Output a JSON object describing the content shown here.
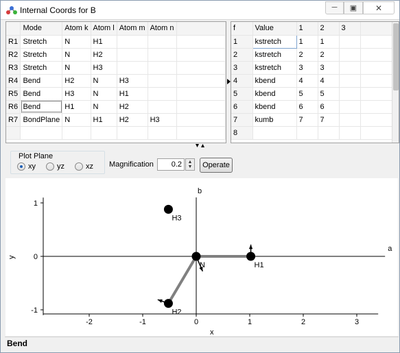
{
  "window": {
    "title": "Internal Coords for B",
    "icons": [
      "app-molecule-icon",
      "minimize-icon",
      "maximize-icon",
      "close-icon"
    ]
  },
  "coords_table": {
    "headers": [
      "",
      "Mode",
      "Atom k",
      "Atom l",
      "Atom m",
      "Atom n"
    ],
    "rows": [
      {
        "id": "R1",
        "mode": "Stretch",
        "k": "N",
        "l": "H1",
        "m": "",
        "n": ""
      },
      {
        "id": "R2",
        "mode": "Stretch",
        "k": "N",
        "l": "H2",
        "m": "",
        "n": ""
      },
      {
        "id": "R3",
        "mode": "Stretch",
        "k": "N",
        "l": "H3",
        "m": "",
        "n": ""
      },
      {
        "id": "R4",
        "mode": "Bend",
        "k": "H2",
        "l": "N",
        "m": "H3",
        "n": ""
      },
      {
        "id": "R5",
        "mode": "Bend",
        "k": "H3",
        "l": "N",
        "m": "H1",
        "n": ""
      },
      {
        "id": "R6",
        "mode": "Bend",
        "k": "H1",
        "l": "N",
        "m": "H2",
        "n": ""
      },
      {
        "id": "R7",
        "mode": "BondPlane",
        "k": "N",
        "l": "H1",
        "m": "H2",
        "n": "H3"
      }
    ]
  },
  "force_table": {
    "headers": [
      "f",
      "Value",
      "1",
      "2",
      "3"
    ],
    "rows": [
      {
        "f": "1",
        "value": "kstretch",
        "c1": "1",
        "c2": "1",
        "c3": ""
      },
      {
        "f": "2",
        "value": "kstretch",
        "c1": "2",
        "c2": "2",
        "c3": ""
      },
      {
        "f": "3",
        "value": "kstretch",
        "c1": "3",
        "c2": "3",
        "c3": ""
      },
      {
        "f": "4",
        "value": "kbend",
        "c1": "4",
        "c2": "4",
        "c3": ""
      },
      {
        "f": "5",
        "value": "kbend",
        "c1": "5",
        "c2": "5",
        "c3": ""
      },
      {
        "f": "6",
        "value": "kbend",
        "c1": "6",
        "c2": "6",
        "c3": ""
      },
      {
        "f": "7",
        "value": "kumb",
        "c1": "7",
        "c2": "7",
        "c3": ""
      },
      {
        "f": "8",
        "value": "",
        "c1": "",
        "c2": "",
        "c3": ""
      }
    ]
  },
  "controls": {
    "plot_plane_label": "Plot Plane",
    "plane_options": [
      "xy",
      "yz",
      "xz"
    ],
    "selected_plane": "xy",
    "magnification_label": "Magnification",
    "magnification_value": "0.2",
    "operate_label": "Operate"
  },
  "status": {
    "text": "Bend"
  },
  "chart_data": {
    "type": "scatter",
    "title": "",
    "xlabel": "x",
    "ylabel": "y",
    "axis_a_label": "a",
    "axis_b_label": "b",
    "xlim": [
      -2.9,
      3.4
    ],
    "ylim": [
      -1.1,
      1.1
    ],
    "x_ticks": [
      -2,
      -1,
      0,
      1,
      2,
      3
    ],
    "y_ticks": [
      -1,
      0,
      1
    ],
    "grid": false,
    "atoms": [
      {
        "name": "N",
        "x": 0.0,
        "y": 0.0
      },
      {
        "name": "H1",
        "x": 1.02,
        "y": 0.0
      },
      {
        "name": "H2",
        "x": -0.52,
        "y": -0.88
      },
      {
        "name": "H3",
        "x": -0.52,
        "y": 0.88
      }
    ],
    "bonds": [
      [
        "N",
        "H1"
      ],
      [
        "N",
        "H2"
      ]
    ],
    "displacements": [
      {
        "atom": "N",
        "dx": 0.12,
        "dy": -0.28
      },
      {
        "atom": "H1",
        "dx": 0.0,
        "dy": 0.22
      },
      {
        "atom": "H2",
        "dx": -0.2,
        "dy": 0.07
      }
    ]
  }
}
